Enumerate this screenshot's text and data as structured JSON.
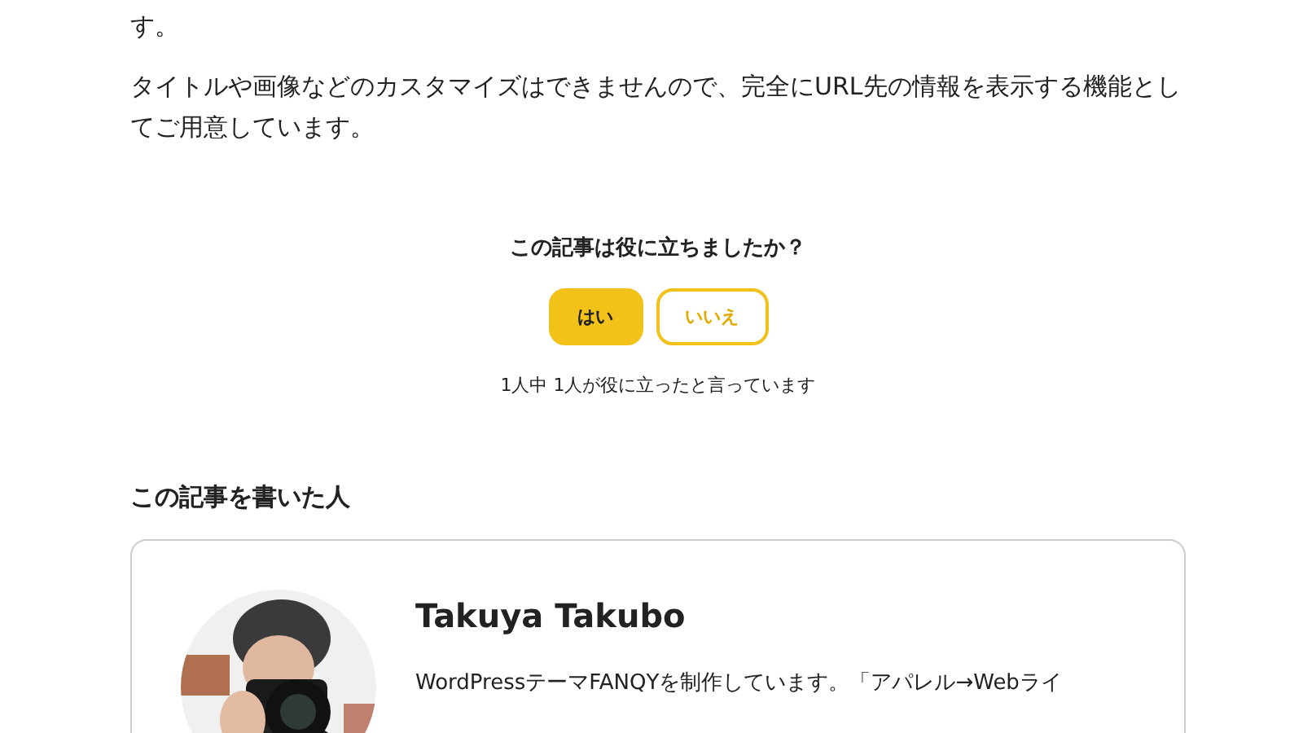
{
  "article": {
    "paragraphs": [
      "す。",
      "タイトルや画像などのカスタマイズはできませんので、完全にURL先の情報を表示する機能としてご用意しています。"
    ]
  },
  "feedback": {
    "question": "この記事は役に立ちましたか？",
    "buttons": [
      {
        "label": "はい",
        "kind": "filled"
      },
      {
        "label": "いいえ",
        "kind": "outline"
      }
    ],
    "count": "1人中 1人が役に立ったと言っています"
  },
  "author": {
    "heading": "この記事を書いた人",
    "name": "Takuya Takubo",
    "bio": "WordPressテーマFANQYを制作しています。「アパレル→Webライ"
  }
}
